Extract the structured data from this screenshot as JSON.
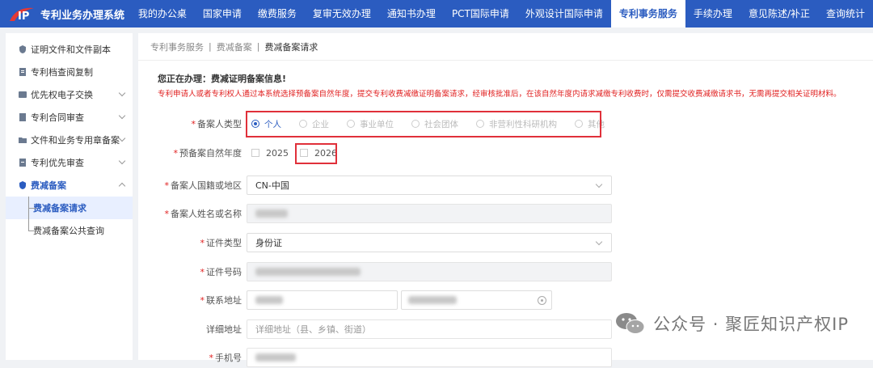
{
  "app": {
    "title": "专利业务办理系统"
  },
  "nav": [
    {
      "label": "我的办公桌"
    },
    {
      "label": "国家申请"
    },
    {
      "label": "缴费服务"
    },
    {
      "label": "复审无效办理"
    },
    {
      "label": "通知书办理"
    },
    {
      "label": "PCT国际申请"
    },
    {
      "label": "外观设计国际申请"
    },
    {
      "label": "专利事务服务",
      "active": true
    },
    {
      "label": "手续办理"
    },
    {
      "label": "意见陈述/补正"
    },
    {
      "label": "查询统计"
    }
  ],
  "sidebar": {
    "items": [
      {
        "label": "证明文件和文件副本"
      },
      {
        "label": "专利档查阅复制"
      },
      {
        "label": "优先权电子交换"
      },
      {
        "label": "专利合同审查"
      },
      {
        "label": "文件和业务专用章备案"
      },
      {
        "label": "专利优先审查"
      },
      {
        "label": "费减备案"
      }
    ],
    "sub_items": [
      {
        "label": "费减备案请求"
      },
      {
        "label": "费减备案公共查询"
      }
    ]
  },
  "breadcrumb": {
    "level1": "专利事务服务",
    "level2": "费减备案",
    "current": "费减备案请求"
  },
  "notice": {
    "title": "您正在办理：费减证明备案信息!",
    "text": "专利申请人或者专利权人通过本系统选择预备案自然年度，提交专利收费减缴证明备案请求，经审核批准后，在该自然年度内请求减缴专利收费时，仅需提交收费减缴请求书，无需再提交相关证明材料。"
  },
  "form": {
    "applicant_type": {
      "label": "备案人类型",
      "options": [
        "个人",
        "企业",
        "事业单位",
        "社会团体",
        "非营利性科研机构",
        "其他"
      ],
      "selected": "个人"
    },
    "year": {
      "label": "预备案自然年度",
      "options": [
        "2025",
        "2026"
      ]
    },
    "nationality": {
      "label": "备案人国籍或地区",
      "value": "CN-中国"
    },
    "name": {
      "label": "备案人姓名或名称"
    },
    "cert_type": {
      "label": "证件类型",
      "value": "身份证"
    },
    "cert_no": {
      "label": "证件号码"
    },
    "address": {
      "label": "联系地址"
    },
    "detail_address": {
      "label": "详细地址",
      "placeholder": "详细地址（县、乡镇、街道）"
    },
    "phone": {
      "label": "手机号"
    }
  },
  "watermark": {
    "text": "公众号 · 聚匠知识产权IP"
  },
  "colors": {
    "brand": "#2b5cc0",
    "required": "#e02020",
    "highlight": "#e0303a"
  }
}
